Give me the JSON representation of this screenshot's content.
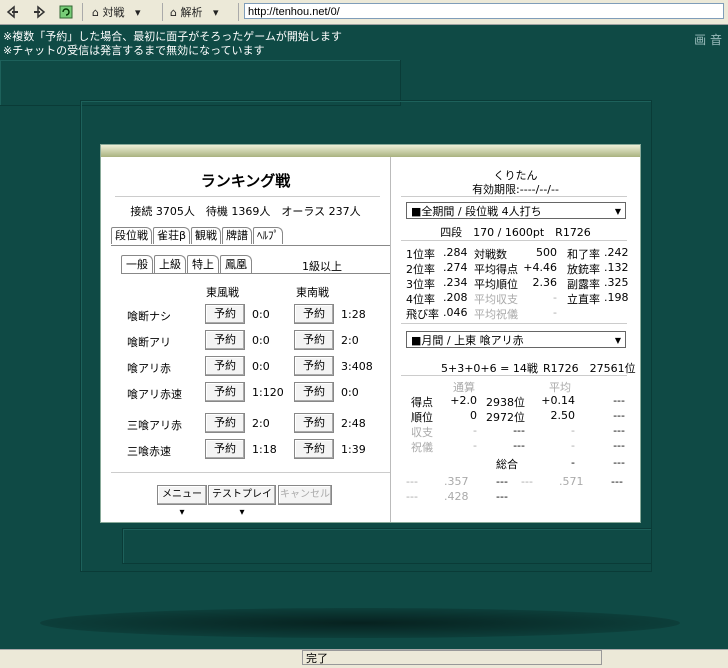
{
  "toolbar": {
    "duisen_label": "対戦",
    "kaiseki_label": "解析",
    "url": "http://tenhou.net/0/"
  },
  "notice": {
    "line1": "※複数「予約」した場合、最初に面子がそろったゲームが開始します",
    "line2": "※チャットの受信は発言するまで無効になっています"
  },
  "brand": "画 音",
  "left": {
    "title": "ランキング戦",
    "stats": "接続 3705人　待機 1369人　オーラス 237人",
    "tabs": [
      "段位戦",
      "雀荘β",
      "観戦",
      "牌譜",
      "ﾍﾙﾌﾟ"
    ],
    "subtabs": [
      "一般",
      "上級",
      "特上",
      "鳳凰"
    ],
    "level": "1級以上",
    "col_east": "東風戦",
    "col_south": "東南戦",
    "reserve": "予約",
    "rows": [
      {
        "label": "喰断ナシ",
        "e": "0:0",
        "s": "1:28"
      },
      {
        "label": "喰断アリ",
        "e": "0:0",
        "s": "2:0"
      },
      {
        "label": "喰アリ赤",
        "e": "0:0",
        "s": "3:408"
      },
      {
        "label": "喰アリ赤速",
        "e": "1:120",
        "s": "0:0"
      },
      {
        "label": "三喰アリ赤",
        "e": "2:0",
        "s": "2:48"
      },
      {
        "label": "三喰赤速",
        "e": "1:18",
        "s": "1:39"
      }
    ],
    "menu": "メニュー ▾",
    "test": "テストプレイ ▾",
    "cancel": "キャンセル"
  },
  "right": {
    "name": "くりたん",
    "expiry": "有効期限:----/--/--",
    "select1": "■全期間 / 段位戦 4人打ち",
    "rank": "四段　170 / 1600pt　R1726",
    "s1": [
      [
        "1位率",
        ".284"
      ],
      [
        "2位率",
        ".274"
      ],
      [
        "3位率",
        ".234"
      ],
      [
        "4位率",
        ".208"
      ],
      [
        "飛び率",
        ".046"
      ]
    ],
    "s2": [
      [
        "対戦数",
        "500"
      ],
      [
        "平均得点",
        "+4.46"
      ],
      [
        "平均順位",
        "2.36"
      ],
      [
        "平均収支",
        "-"
      ],
      [
        "平均祝儀",
        "-"
      ]
    ],
    "s3": [
      [
        "和了率",
        ".242"
      ],
      [
        "放銃率",
        ".132"
      ],
      [
        "副露率",
        ".325"
      ],
      [
        "立直率",
        ".198"
      ]
    ],
    "select2": "■月間 / 上東 喰アリ赤",
    "summary": "5+3+0+6 = 14戦",
    "summary_r": "R1726　27561位",
    "h_total": "通算",
    "h_avg": "平均",
    "t": [
      [
        "得点",
        "+2.0",
        "2938位",
        "+0.14",
        "---"
      ],
      [
        "順位",
        "0",
        "2972位",
        "2.50",
        "---"
      ],
      [
        "収支",
        "-",
        "---",
        "-",
        "---"
      ],
      [
        "祝儀",
        "-",
        "---",
        "-",
        "---"
      ]
    ],
    "sogo": "総合",
    "sogo_v": "-",
    "sogo_v2": "---",
    "x1": [
      "---",
      ".357",
      "---",
      "---",
      ".571",
      "---"
    ],
    "x2": [
      "---",
      ".428",
      "---"
    ]
  },
  "status": "完了"
}
